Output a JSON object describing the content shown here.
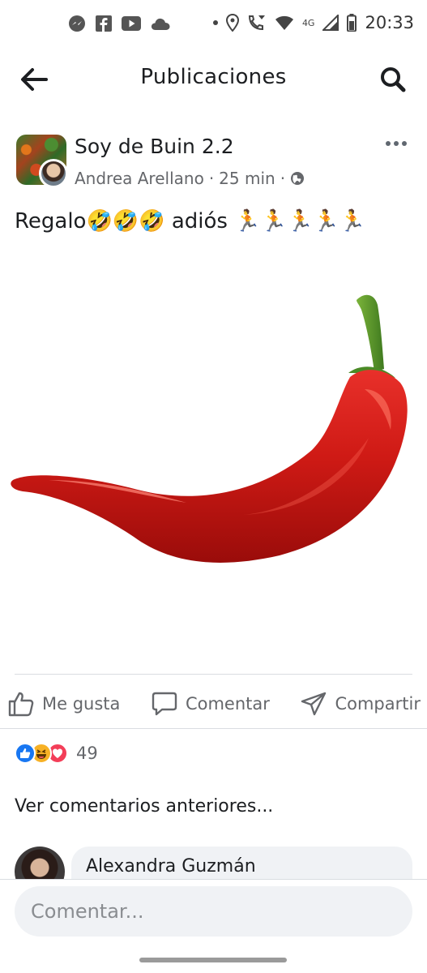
{
  "status_bar": {
    "network": "4G",
    "time": "20:33"
  },
  "header": {
    "title": "Publicaciones"
  },
  "post": {
    "group_name": "Soy de Buin 2.2",
    "author": "Andrea Arellano",
    "separator": "·",
    "time_ago": "25 min",
    "text": "Regalo🤣🤣🤣 adiós 🏃🏃🏃🏃🏃",
    "image_description_icon": "chili-pepper-image"
  },
  "actions": {
    "like_label": "Me gusta",
    "comment_label": "Comentar",
    "share_label": "Compartir"
  },
  "reactions": {
    "types": [
      "like",
      "haha",
      "love"
    ],
    "count": "49"
  },
  "comments": {
    "previous_label": "Ver comentarios anteriores...",
    "preview_author": "Alexandra Guzmán"
  },
  "composer": {
    "placeholder": "Comentar..."
  },
  "colors": {
    "accent": "#1877f2",
    "text_primary": "#1c1e21",
    "text_secondary": "#65676b",
    "chili_red": "#c81414",
    "chili_stem": "#5a9a2a"
  }
}
